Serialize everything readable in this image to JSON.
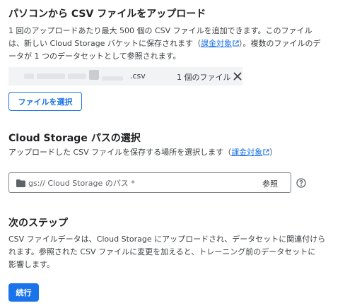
{
  "upload_section": {
    "title": "パソコンから CSV ファイルをアップロード",
    "desc_line1": "1 回のアップロードあたり最大 500 個の CSV ファイルを追加できます。このファイル",
    "desc_line2_before": "は、新しい Cloud Storage バケットに保存されます（",
    "desc_link": "課金対象",
    "desc_line2_after": "）。複数のファイルのデ",
    "desc_line3": "ータが 1 つのデータセットとして参照されます。",
    "file": {
      "extension": ".csv",
      "count_label": "1 個のファイル"
    },
    "select_button": "ファイルを選択"
  },
  "storage_section": {
    "title": "Cloud Storage パスの選択",
    "desc_before": "アップロードした CSV ファイルを保存する場所を選択します（",
    "desc_link": "課金対象",
    "desc_after": "）",
    "path_field": {
      "placeholder": "gs:// Cloud Storage のパス *",
      "value": "",
      "browse_label": "参照"
    },
    "icons": {
      "folder": "folder-icon",
      "help": "help-icon",
      "external_link": "external-link-icon"
    }
  },
  "next_section": {
    "title": "次のステップ",
    "desc_line1": "CSV ファイルデータは、Cloud Storage にアップロードされ、データセットに関連付けら",
    "desc_line2": "れます。参照された CSV ファイルに変更を加えると、トレーニング前のデータセットに",
    "desc_line3": "影響します。",
    "continue_button": "続行"
  },
  "colors": {
    "accent": "#1a73e8",
    "text": "#202124",
    "secondary_text": "#3c4043",
    "file_row_bg": "#f1f3f4"
  }
}
